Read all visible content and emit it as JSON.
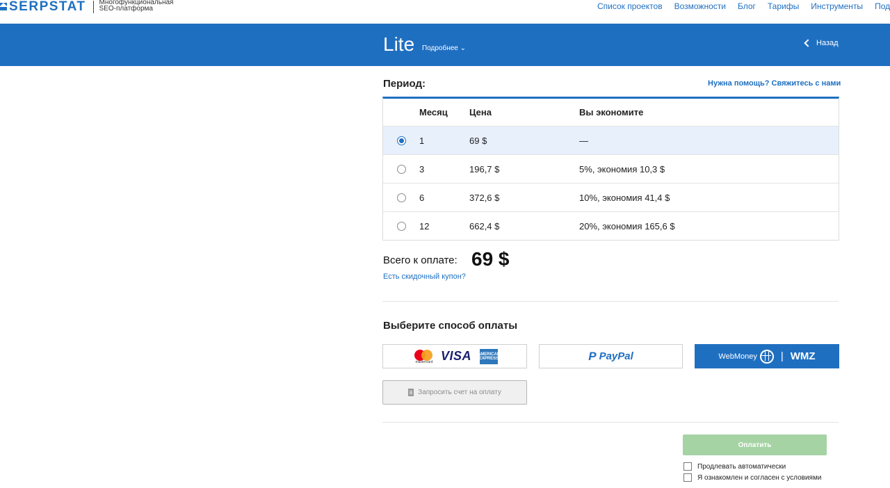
{
  "brand": {
    "name": "SERPSTAT",
    "tagline_line1": "Многофункциональная",
    "tagline_line2": "SEO-платформа"
  },
  "nav": {
    "items": [
      "Список проектов",
      "Возможности",
      "Блог",
      "Тарифы",
      "Инструменты",
      "Подде"
    ]
  },
  "plan": {
    "title": "Lite",
    "more_label": "Подробнее ⌄",
    "back_label": "Назад"
  },
  "period": {
    "label": "Период:",
    "help_link": "Нужна помощь? Свяжитесь с нами",
    "columns": {
      "month": "Месяц",
      "price": "Цена",
      "savings": "Вы экономите"
    },
    "rows": [
      {
        "month": "1",
        "price": "69 $",
        "savings": "—",
        "selected": true
      },
      {
        "month": "3",
        "price": "196,7 $",
        "savings": "5%, экономия 10,3 $",
        "selected": false
      },
      {
        "month": "6",
        "price": "372,6 $",
        "savings": "10%, экономия 41,4 $",
        "selected": false
      },
      {
        "month": "12",
        "price": "662,4 $",
        "savings": "20%, экономия 165,6 $",
        "selected": false
      }
    ]
  },
  "total": {
    "label": "Всего к оплате:",
    "value": "69 $",
    "coupon_link": "Есть скидочный купон?"
  },
  "payment": {
    "title": "Выберите способ оплаты",
    "card": {
      "mastercard_text": "mastercard",
      "visa_text": "VISA",
      "amex_text": "AMERICAN EXPRESS"
    },
    "paypal": {
      "icon": "P",
      "text": "PayPal"
    },
    "webmoney": {
      "name": "WebMoney",
      "separator": "|",
      "code": "WMZ"
    },
    "invoice_label": "Запросить счет на оплату"
  },
  "submit": {
    "label": "Оплатить"
  },
  "options": {
    "auto_renew": "Продлевать автоматически",
    "agree_terms": "Я ознакомлен и согласен с условиями"
  },
  "colors": {
    "brand_blue": "#1f6fc1",
    "selected_row": "#e8f0fc",
    "pay_button": "#a5d3a4"
  }
}
